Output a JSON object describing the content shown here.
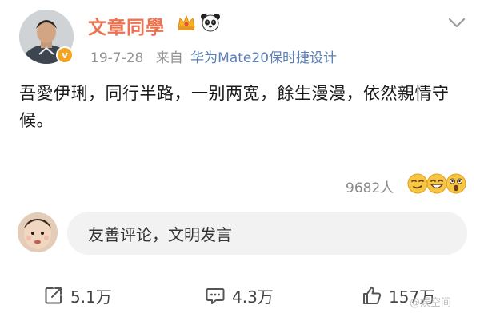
{
  "post": {
    "author": {
      "name": "文章同學",
      "badges": [
        "crown-icon",
        "panda-icon"
      ],
      "verified": true
    },
    "date": "19-7-28",
    "source_prefix": "来自",
    "source": "华为Mate20保时捷设计",
    "text": "吾愛伊琍，同行半路，一别两宽，餘生漫漫，依然親情守候。"
  },
  "reactions": {
    "count_label": "9682人",
    "emojis": [
      "smirk-emoji",
      "grin-emoji",
      "shocked-emoji"
    ]
  },
  "comment_box": {
    "placeholder": "友善评论，文明发言"
  },
  "actions": {
    "repost_label": "5.1万",
    "comment_label": "4.3万",
    "like_label": "157万"
  },
  "watermark": "@娱空间",
  "colors": {
    "username": "#eb7350",
    "source_link": "#5a7fb5",
    "verified_badge": "#f4a323",
    "meta_text": "#939393"
  }
}
